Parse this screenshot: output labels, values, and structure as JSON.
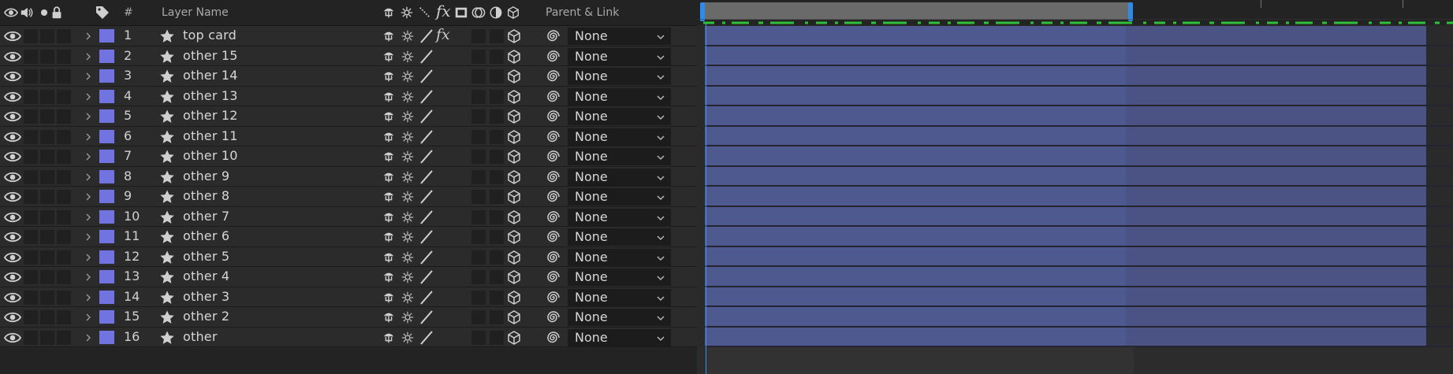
{
  "header": {
    "layer_name_label": "Layer Name",
    "number_label": "#",
    "parent_link_label": "Parent & Link",
    "fx_label": "fx"
  },
  "colors": {
    "label": "#7174e0",
    "bar": "#4e5a8f",
    "bar_outside": "#4a5384",
    "playhead": "#3a8ef0",
    "work_area_handle": "#2d8ceb",
    "cache_line": "#2fbf3a"
  },
  "layers": [
    {
      "num": "1",
      "name": "top card",
      "parent": "None",
      "fx": "fx"
    },
    {
      "num": "2",
      "name": "other 15",
      "parent": "None",
      "fx": ""
    },
    {
      "num": "3",
      "name": "other 14",
      "parent": "None",
      "fx": ""
    },
    {
      "num": "4",
      "name": "other 13",
      "parent": "None",
      "fx": ""
    },
    {
      "num": "5",
      "name": "other 12",
      "parent": "None",
      "fx": ""
    },
    {
      "num": "6",
      "name": "other 11",
      "parent": "None",
      "fx": ""
    },
    {
      "num": "7",
      "name": "other 10",
      "parent": "None",
      "fx": ""
    },
    {
      "num": "8",
      "name": "other 9",
      "parent": "None",
      "fx": ""
    },
    {
      "num": "9",
      "name": "other 8",
      "parent": "None",
      "fx": ""
    },
    {
      "num": "10",
      "name": "other 7",
      "parent": "None",
      "fx": ""
    },
    {
      "num": "11",
      "name": "other 6",
      "parent": "None",
      "fx": ""
    },
    {
      "num": "12",
      "name": "other 5",
      "parent": "None",
      "fx": ""
    },
    {
      "num": "13",
      "name": "other 4",
      "parent": "None",
      "fx": ""
    },
    {
      "num": "14",
      "name": "other 3",
      "parent": "None",
      "fx": ""
    },
    {
      "num": "15",
      "name": "other 2",
      "parent": "None",
      "fx": ""
    },
    {
      "num": "16",
      "name": "other",
      "parent": "None",
      "fx": ""
    }
  ]
}
